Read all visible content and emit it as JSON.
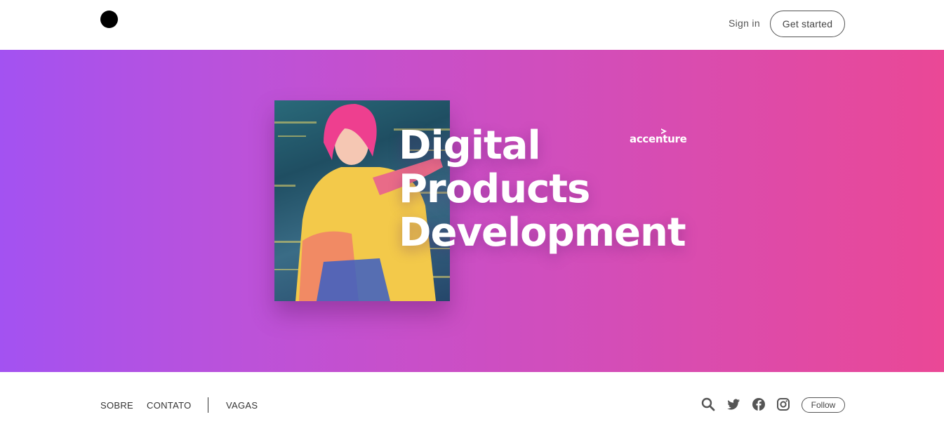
{
  "header": {
    "logo_icon": "black-dot-logo",
    "sign_in_label": "Sign in",
    "get_started_label": "Get started"
  },
  "hero": {
    "title_lines": [
      "Digital",
      "Products",
      "Development"
    ],
    "brand": "accenture",
    "image": "woman-pink-hair-neon-photo",
    "gradient": [
      "#a352f1",
      "#ea4896"
    ]
  },
  "nav": {
    "links": [
      "SOBRE",
      "CONTATO",
      "VAGAS"
    ],
    "icons": [
      "search-icon",
      "twitter-icon",
      "facebook-icon",
      "instagram-icon"
    ],
    "follow_label": "Follow"
  }
}
